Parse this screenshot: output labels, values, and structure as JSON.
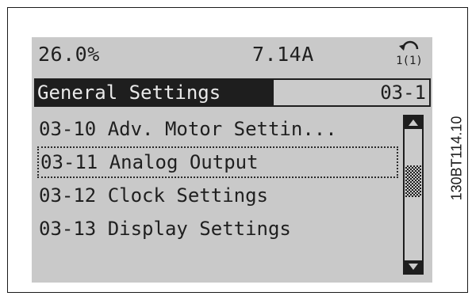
{
  "status": {
    "percent": "26.0%",
    "current": "7.14A",
    "setup_icon": "setup-indicator-icon"
  },
  "header": {
    "group_title": "General Settings",
    "group_code": "03-1"
  },
  "menu": {
    "items": [
      {
        "label": "03-10 Adv. Motor Settin..."
      },
      {
        "label": "03-11 Analog Output"
      },
      {
        "label": "03-12 Clock Settings"
      },
      {
        "label": "03-13 Display Settings"
      }
    ],
    "selected_index": 1
  },
  "figure_code": "130BT114.10",
  "colors": {
    "lcd_background": "#c9c9c9",
    "lcd_foreground": "#1e1e1e"
  }
}
